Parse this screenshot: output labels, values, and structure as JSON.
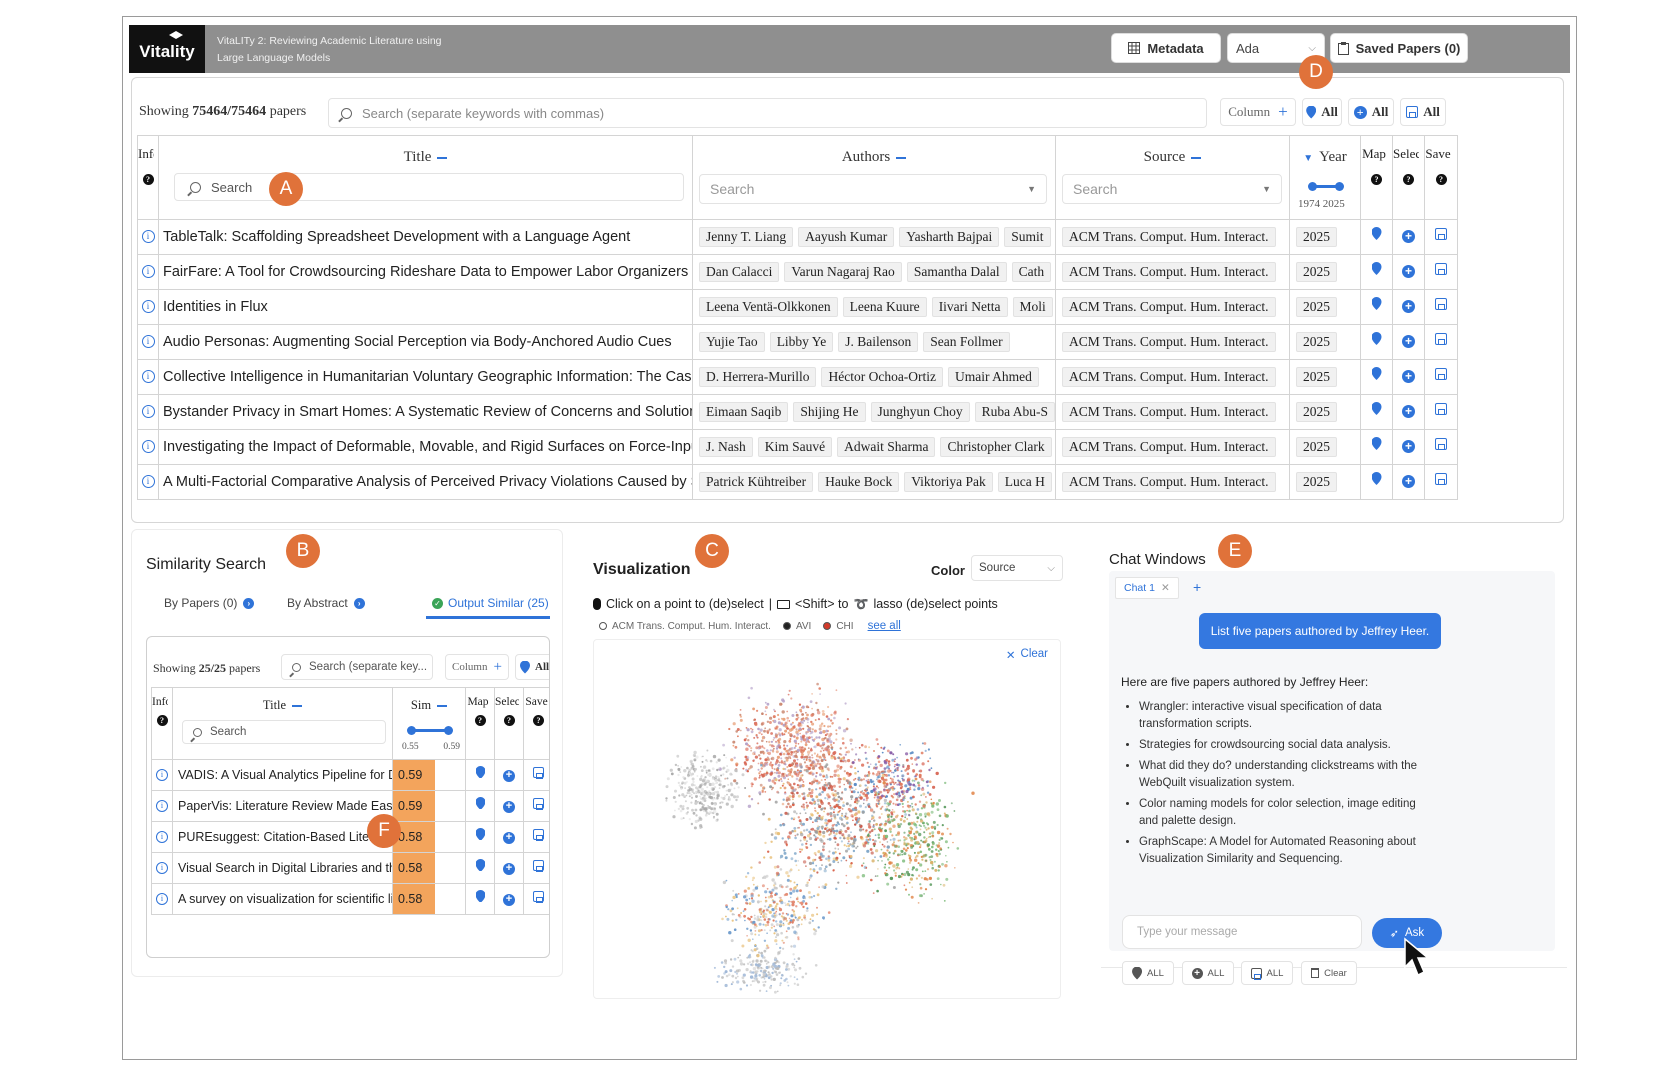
{
  "app": {
    "logo": "Vitality",
    "title_line1": "VitaLITy 2: Reviewing Academic Literature using",
    "title_line2": "Large Language Models",
    "metadata_label": "Metadata",
    "model_select": "Ada",
    "saved_label": "Saved Papers (0)"
  },
  "badges": {
    "a": "A",
    "b": "B",
    "c": "C",
    "d": "D",
    "e": "E",
    "f": "F"
  },
  "main": {
    "showing_prefix": "Showing",
    "showing_count": "75464/75464",
    "showing_suffix": "papers",
    "search_placeholder": "Search (separate keywords with commas)",
    "column_label": "Column",
    "all_label": "All",
    "headers": {
      "info": "Info",
      "title": "Title",
      "authors": "Authors",
      "source": "Source",
      "year": "Year",
      "map": "Map",
      "select": "Select",
      "save": "Save"
    },
    "title_search": "Search",
    "authors_search": "Search",
    "source_search": "Search",
    "year_min": "1974",
    "year_max": "2025",
    "rows": [
      {
        "title": "TableTalk: Scaffolding Spreadsheet Development with a Language Agent",
        "authors": [
          "Jenny T. Liang",
          "Aayush Kumar",
          "Yasharth Bajpai",
          "Sumit"
        ],
        "source": "ACM Trans. Comput. Hum. Interact.",
        "year": "2025"
      },
      {
        "title": "FairFare: A Tool for Crowdsourcing Rideshare Data to Empower Labor Organizers",
        "authors": [
          "Dan Calacci",
          "Varun Nagaraj Rao",
          "Samantha Dalal",
          "Cath"
        ],
        "source": "ACM Trans. Comput. Hum. Interact.",
        "year": "2025"
      },
      {
        "title": "Identities in Flux",
        "authors": [
          "Leena Ventä-Olkkonen",
          "Leena Kuure",
          "Iivari Netta",
          "Moli"
        ],
        "source": "ACM Trans. Comput. Hum. Interact.",
        "year": "2025"
      },
      {
        "title": "Audio Personas: Augmenting Social Perception via Body-Anchored Audio Cues",
        "authors": [
          "Yujie Tao",
          "Libby Ye",
          "J. Bailenson",
          "Sean Follmer"
        ],
        "source": "ACM Trans. Comput. Hum. Interact.",
        "year": "2025"
      },
      {
        "title": "Collective Intelligence in Humanitarian Voluntary Geographic Information: The Case",
        "authors": [
          "D. Herrera-Murillo",
          "Héctor Ochoa-Ortiz",
          "Umair Ahmed"
        ],
        "source": "ACM Trans. Comput. Hum. Interact.",
        "year": "2025"
      },
      {
        "title": "Bystander Privacy in Smart Homes: A Systematic Review of Concerns and Solutions",
        "authors": [
          "Eimaan Saqib",
          "Shijing He",
          "Junghyun Choy",
          "Ruba Abu-S"
        ],
        "source": "ACM Trans. Comput. Hum. Interact.",
        "year": "2025"
      },
      {
        "title": "Investigating the Impact of Deformable, Movable, and Rigid Surfaces on Force-Inpu",
        "authors": [
          "J. Nash",
          "Kim Sauvé",
          "Adwait Sharma",
          "Christopher Clark"
        ],
        "source": "ACM Trans. Comput. Hum. Interact.",
        "year": "2025"
      },
      {
        "title": "A Multi-Factorial Comparative Analysis of Perceived Privacy Violations Caused by S",
        "authors": [
          "Patrick Kühtreiber",
          "Hauke Bock",
          "Viktoriya Pak",
          "Luca H"
        ],
        "source": "ACM Trans. Comput. Hum. Interact.",
        "year": "2025"
      }
    ]
  },
  "similarity": {
    "title": "Similarity Search",
    "tab_papers": "By Papers (0)",
    "tab_abstract": "By Abstract",
    "tab_output": "Output Similar (25)",
    "showing_prefix": "Showing",
    "showing_count": "25/25",
    "showing_suffix": "papers",
    "search_placeholder": "Search (separate key...",
    "column_label": "Column",
    "all_label": "All",
    "headers": {
      "info": "Info",
      "title": "Title",
      "sim": "Sim",
      "map": "Map",
      "select": "Select",
      "save": "Save"
    },
    "title_search": "Search",
    "sim_min": "0.55",
    "sim_max": "0.59",
    "rows": [
      {
        "title": "VADIS: A Visual Analytics Pipeline for Dynamic Document",
        "sim": "0.59"
      },
      {
        "title": "PaperVis: Literature Review Made Easy",
        "sim": "0.59"
      },
      {
        "title": "PURE​suggest: Citation-Based Literature Search",
        "sim": "0.58"
      },
      {
        "title": "Visual Search in Digital Libraries and the Usage",
        "sim": "0.58"
      },
      {
        "title": "A survey on visualization for scientific literature",
        "sim": "0.58"
      }
    ]
  },
  "viz": {
    "title": "Visualization",
    "color_label": "Color",
    "color_select": "Source",
    "hint_click": "Click on a point to (de)select",
    "hint_sep": "|",
    "hint_shift": "<Shift> to",
    "hint_lasso": "lasso (de)select points",
    "legend": [
      {
        "label": "ACM Trans. Comput. Hum. Interact.",
        "color": "#ffffff"
      },
      {
        "label": "AVI",
        "color": "#222222"
      },
      {
        "label": "CHI",
        "color": "#d23a2a"
      }
    ],
    "see_all": "see all",
    "clear_label": "Clear"
  },
  "chat": {
    "title": "Chat Windows",
    "tab_label": "Chat 1",
    "user_msg": "List five papers authored by Jeffrey Heer.",
    "reply_intro": "Here are five papers authored by Jeffrey Heer:",
    "reply_items": [
      "Wrangler: interactive visual specification of data transformation scripts.",
      "Strategies for crowdsourcing social data analysis.",
      "What did they do? understanding clickstreams with the WebQuilt visualization system.",
      "Color naming models for color selection, image editing and palette design.",
      "GraphScape: A Model for Automated Reasoning about Visualization Similarity and Sequencing."
    ],
    "input_placeholder": "Type your message",
    "ask_label": "Ask",
    "all_label": "ALL",
    "clear_label": "Clear"
  }
}
